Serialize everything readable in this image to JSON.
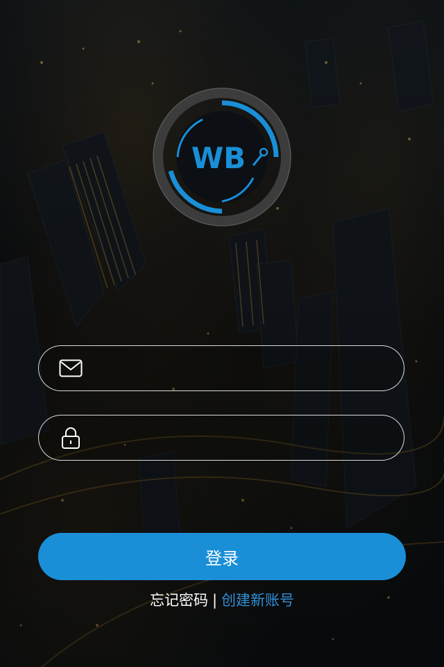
{
  "app": {
    "logo_text": "WB",
    "brand_color": "#1a8fd8",
    "logo_ring_color": "#3a3a3a"
  },
  "form": {
    "email": {
      "icon": "mail-icon",
      "value": "",
      "placeholder": ""
    },
    "password": {
      "icon": "lock-icon",
      "value": "",
      "placeholder": ""
    },
    "login_label": "登录"
  },
  "links": {
    "forgot_password": "忘记密码",
    "separator": "|",
    "create_account": "创建新账号",
    "create_color": "#2f8fd6"
  }
}
